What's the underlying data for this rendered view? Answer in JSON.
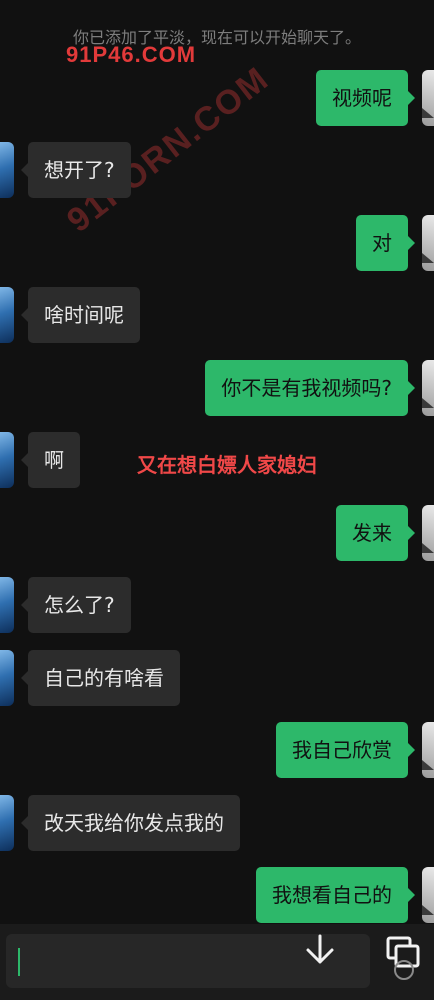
{
  "system_message": "你已添加了平淡，现在可以开始聊天了。",
  "watermarks": {
    "top": "91P46.COM",
    "diagonal": "91PORN.COM"
  },
  "overlay_text": "又在想白嫖人家媳妇",
  "messages": [
    {
      "side": "out",
      "text": "视频呢"
    },
    {
      "side": "in",
      "text": "想开了?"
    },
    {
      "side": "out",
      "text": "对"
    },
    {
      "side": "in",
      "text": "啥时间呢"
    },
    {
      "side": "out",
      "text": "你不是有我视频吗?"
    },
    {
      "side": "in",
      "text": "啊"
    },
    {
      "side": "out",
      "text": "发来"
    },
    {
      "side": "in",
      "text": "怎么了?"
    },
    {
      "side": "in",
      "text": "自己的有啥看"
    },
    {
      "side": "out",
      "text": "我自己欣赏"
    },
    {
      "side": "in",
      "text": "改天我给你发点我的"
    },
    {
      "side": "out",
      "text": "我想看自己的"
    }
  ],
  "input_bar": {
    "value": ""
  },
  "icons": {
    "scroll_down": "arrow-down-icon",
    "multi_window": "overlapping-squares-icon"
  },
  "colors": {
    "background": "#111111",
    "outgoing_bubble": "#2db86a",
    "incoming_bubble": "#2c2c2c",
    "overlay_text": "#f04848",
    "watermark": "#e23a3a"
  }
}
